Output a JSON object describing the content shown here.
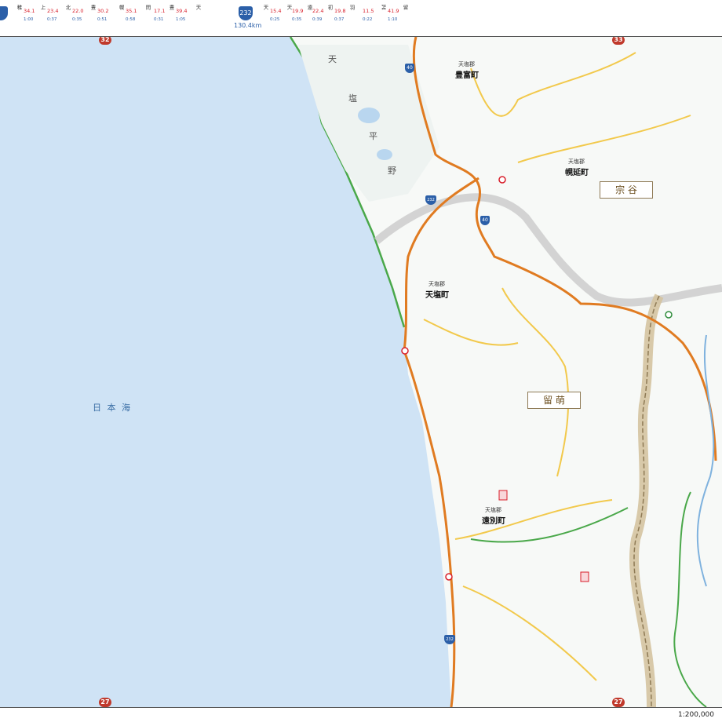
{
  "header": {
    "route_a": {
      "shield": "",
      "distance": "",
      "stops": [
        "稚",
        "上",
        "北",
        "豊",
        "幌",
        "問",
        "豊",
        "天"
      ],
      "segments": [
        "34.1",
        "23.4",
        "22.0",
        "30.2",
        "35.1",
        "17.1",
        "39.4"
      ],
      "seg_sub": [
        "1:00",
        "0:37",
        "0:35",
        "0:51",
        "0:58",
        "0:31",
        "1:05"
      ]
    },
    "route_b": {
      "shield": "232",
      "distance": "130.4km",
      "stops": [
        "天",
        "天",
        "遠",
        "初",
        "羽",
        "苫",
        "留"
      ],
      "segments": [
        "15.4",
        "19.9",
        "22.4",
        "19.8",
        "11.5",
        "41.9"
      ],
      "seg_sub": [
        "0:25",
        "0:35",
        "0:39",
        "0:37",
        "0:22",
        "1:10"
      ]
    }
  },
  "grid": {
    "top_left": "32",
    "top_right": "33",
    "bottom_left": "27",
    "bottom_right": "27"
  },
  "sea_label": "日 本 海",
  "region_labels": [
    "宗 谷",
    "留 萌"
  ],
  "plain_chars": [
    "天",
    "塩",
    "平",
    "野"
  ],
  "towns": [
    {
      "district": "天塩郡",
      "name": "豊富町"
    },
    {
      "district": "天塩郡",
      "name": "幌延町"
    },
    {
      "district": "天塩郡",
      "name": "天塩町"
    },
    {
      "district": "天塩郡",
      "name": "遠別町"
    }
  ],
  "route_numbers": {
    "national_40": "40",
    "national_232": "232"
  },
  "scale_text": "1:200,000",
  "colors": {
    "sea": "#cfe3f5",
    "land": "#f7f9f7",
    "national_route": "#e07b21",
    "pref_road": "#f2c94c",
    "boundary": "#b8a98a",
    "rail": "#4aa84a",
    "shield": "#2b5fa8",
    "grid_marker": "#c0392b"
  }
}
